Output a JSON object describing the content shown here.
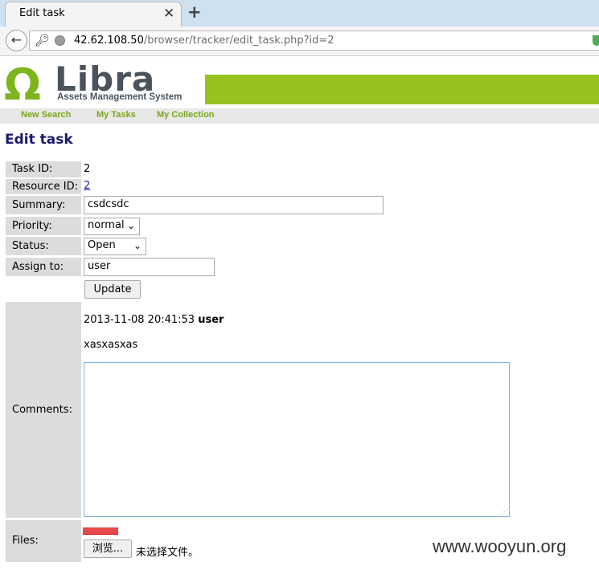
{
  "browser": {
    "tab_title": "Edit task",
    "tab_close": "✕",
    "new_tab": "+",
    "url_host": "42.62.108.50",
    "url_path": "/browser/tracker/edit_task.php?id=2"
  },
  "header": {
    "logo_symbol": "Ω",
    "logo_text": "Libra",
    "tagline": "Assets Management System",
    "accent_color": "#96c11f"
  },
  "menu": {
    "items": [
      "New Search",
      "My Tasks",
      "My Collection"
    ]
  },
  "page": {
    "title": "Edit task"
  },
  "form": {
    "task_id_label": "Task ID:",
    "task_id": "2",
    "resource_id_label": "Resource ID:",
    "resource_id": "2",
    "summary_label": "Summary:",
    "summary_value": "csdcsdc",
    "priority_label": "Priority:",
    "priority_value": "normal",
    "status_label": "Status:",
    "status_value": "Open",
    "assign_label": "Assign to:",
    "assign_value": "user",
    "update_button": "Update",
    "comments_label": "Comments:",
    "comment": {
      "timestamp": "2013-11-08 20:41:53",
      "author": "user",
      "text": "xasxasxas"
    },
    "files_label": "Files:",
    "browse_button": "浏览...",
    "no_file_text": "未选择文件。"
  },
  "watermark": "www.wooyun.org"
}
